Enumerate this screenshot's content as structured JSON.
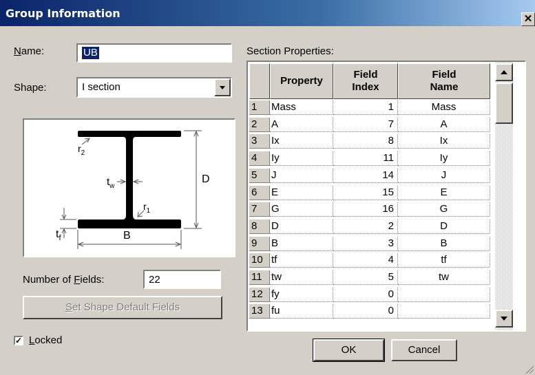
{
  "window": {
    "title": "Group Information",
    "close_glyph": "✕"
  },
  "name": {
    "label_prefix": "",
    "label_u": "N",
    "label_rest": "ame:",
    "value": "UB"
  },
  "shape": {
    "label": "Shape:",
    "value": "I section"
  },
  "diagram": {
    "label_r2": "r",
    "label_r2_sub": "2",
    "label_tw": "t",
    "label_tw_sub": "w",
    "label_D": "D",
    "label_r1": "r",
    "label_r1_sub": "1",
    "label_tf": "t",
    "label_tf_sub": "f",
    "label_B": "B"
  },
  "fields": {
    "label_prefix": "Number of ",
    "label_u": "F",
    "label_rest": "ields:",
    "value": "22"
  },
  "default_button": {
    "label_u": "S",
    "label_rest": "et Shape Default Fields"
  },
  "locked": {
    "label_u": "L",
    "label_rest": "ocked",
    "checked": true,
    "check_glyph": "✓"
  },
  "section": {
    "label": "Section Properties:",
    "headers": [
      "Property",
      "Field Index",
      "Field Name"
    ],
    "rows": [
      {
        "n": "1",
        "property": "Mass",
        "index": "1",
        "name": "Mass"
      },
      {
        "n": "2",
        "property": "A",
        "index": "7",
        "name": "A"
      },
      {
        "n": "3",
        "property": "Ix",
        "index": "8",
        "name": "Ix"
      },
      {
        "n": "4",
        "property": "Iy",
        "index": "11",
        "name": "Iy"
      },
      {
        "n": "5",
        "property": "J",
        "index": "14",
        "name": "J"
      },
      {
        "n": "6",
        "property": "E",
        "index": "15",
        "name": "E"
      },
      {
        "n": "7",
        "property": "G",
        "index": "16",
        "name": "G"
      },
      {
        "n": "8",
        "property": "D",
        "index": "2",
        "name": "D"
      },
      {
        "n": "9",
        "property": "B",
        "index": "3",
        "name": "B"
      },
      {
        "n": "10",
        "property": "tf",
        "index": "4",
        "name": "tf"
      },
      {
        "n": "11",
        "property": "tw",
        "index": "5",
        "name": "tw"
      },
      {
        "n": "12",
        "property": "fy",
        "index": "0",
        "name": ""
      },
      {
        "n": "13",
        "property": "fu",
        "index": "0",
        "name": ""
      }
    ]
  },
  "buttons": {
    "ok": "OK",
    "cancel": "Cancel"
  }
}
